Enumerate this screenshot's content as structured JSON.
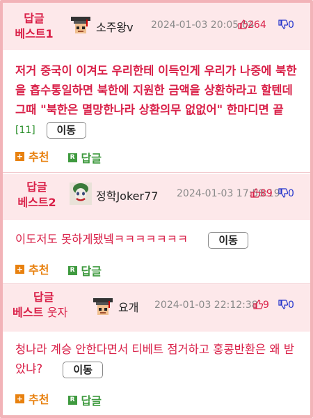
{
  "comments": [
    {
      "badge_line1": "답글",
      "badge_line2": "베스트1",
      "nickname": "소주왕v",
      "date": "2024-01-03 20:05:04",
      "likes": "264",
      "dislikes": "0",
      "text": "저거 중국이 이겨도 우리한테 이득인게 우리가 나중에 북한을 흡수통일하면 북한에 지원한 금액을 상환하라고 할텐데 그때 \"북한은 멸망한나라 상환의무 없없어\" 한마디면 끝",
      "reply_count": "[11]",
      "move_label": "이동",
      "recommend_label": "추천",
      "reply_label": "답글"
    },
    {
      "badge_line1": "답글",
      "badge_line2": "베스트2",
      "nickname": "정학Joker77",
      "date": "2024-01-03 17:58:19",
      "likes": "89",
      "dislikes": "0",
      "text": "이도저도 못하게됐넼ㅋㅋㅋㅋㅋㅋㅋ",
      "move_label": "이동",
      "recommend_label": "추천",
      "reply_label": "답글"
    },
    {
      "badge_line1": "답글",
      "badge_line2": "베스트",
      "badge_sub": "웃자",
      "nickname": "요개",
      "date": "2024-01-03 22:12:38",
      "likes": "9",
      "dislikes": "0",
      "text": "청나라 계승 안한다면서 티베트 점거하고 홍콩반환은 왜 받았냐?",
      "move_label": "이동",
      "recommend_label": "추천",
      "reply_label": "답글"
    }
  ],
  "colors": {
    "accent": "#d92048",
    "header_bg": "#fde8ea",
    "recommend": "#e8810f",
    "reply": "#3f9a3f",
    "dislike": "#2233cc"
  },
  "icons": [
    "graduation-cap-pixel-avatar",
    "joker-avatar",
    "thumbs-up-icon",
    "thumbs-down-icon",
    "plus-icon",
    "r-icon"
  ]
}
